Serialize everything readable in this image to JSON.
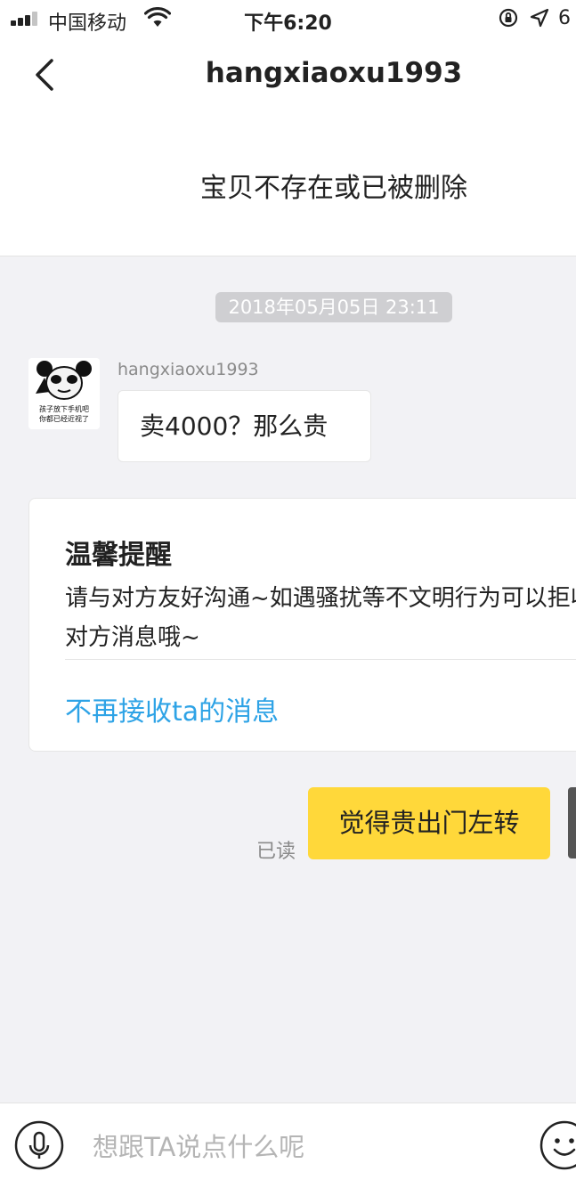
{
  "status_bar": {
    "carrier": "中国移动",
    "time": "下午6:20",
    "battery_text": "6"
  },
  "nav": {
    "title": "hangxiaoxu1993"
  },
  "item_banner": {
    "text": "宝贝不存在或已被删除"
  },
  "chat": {
    "timestamp": "2018年05月05日 23:11",
    "incoming": {
      "sender": "hangxiaoxu1993",
      "avatar_caption_line1": "孩子放下手机吧",
      "avatar_caption_line2": "你都已经近视了",
      "text": "卖4000？那么贵"
    },
    "tip": {
      "title": "温馨提醒",
      "body": "请与对方友好沟通~如遇骚扰等不文明行为可以拒收对方消息哦~",
      "link": "不再接收ta的消息"
    },
    "outgoing": {
      "read_label": "已读",
      "text": "觉得贵出门左转"
    }
  },
  "input_bar": {
    "placeholder": "想跟TA说点什么呢"
  }
}
